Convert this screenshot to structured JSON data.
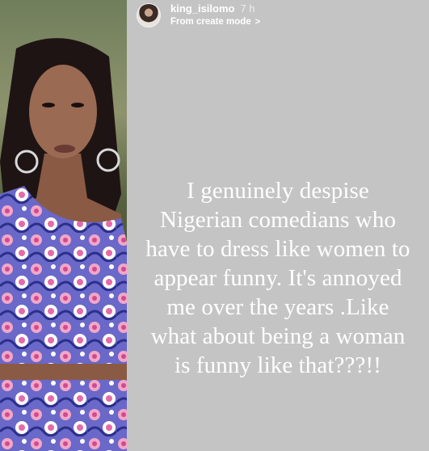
{
  "story": {
    "username": "king_isilomo",
    "time": "7 h",
    "mode_label": "From create mode",
    "mode_chevron": ">",
    "text_lines": [
      "I genuinely despise",
      "Nigerian comedians who",
      "have to dress like women to",
      "appear funny. It's annoyed",
      "me over the years .Like",
      "what about being a woman",
      "is funny like that???!!"
    ]
  },
  "colors": {
    "story_background": "#c4c4c4",
    "text": "#ffffff"
  },
  "icons": {
    "avatar": "avatar",
    "chevron": "chevron-right-icon"
  }
}
